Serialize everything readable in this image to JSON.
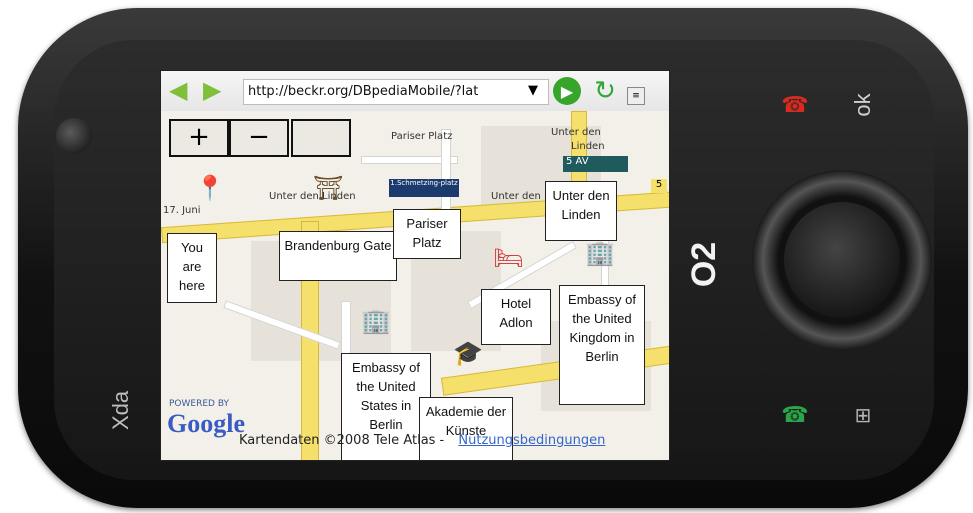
{
  "device": {
    "brand_left": "Xda",
    "brand_right": "O2",
    "ok_label": "ok"
  },
  "browser": {
    "url": "http://beckr.org/DBpediaMobile/?lat",
    "back_icon": "arrow-left-icon",
    "forward_icon": "arrow-right-icon",
    "go_icon": "play-icon",
    "reload_icon": "refresh-icon"
  },
  "map": {
    "zoom_in_label": "+",
    "zoom_out_label": "−",
    "streets": [
      "Pariser Platz",
      "Unter den Linden",
      "Unter den Lind",
      "Unter den",
      "Linden",
      "17. Juni"
    ],
    "signs": [
      "5 AV",
      "1.Schmetzing-platz",
      "5"
    ],
    "callouts": [
      {
        "text": "You are here"
      },
      {
        "text": "Brandenburg Gate"
      },
      {
        "text": "Pariser Platz"
      },
      {
        "text": "Unter den Linden"
      },
      {
        "text": "Hotel Adlon"
      },
      {
        "text": "Embassy of the United Kingdom in Berlin"
      },
      {
        "text": "Embassy of the United States in Berlin"
      },
      {
        "text": "Akademie der Künste"
      }
    ],
    "powered_by": "POWERED BY",
    "google_logo": "Google",
    "copyright": "Kartendaten ©2008 Tele Atlas -",
    "terms_link": "Nutzungsbedingungen"
  }
}
